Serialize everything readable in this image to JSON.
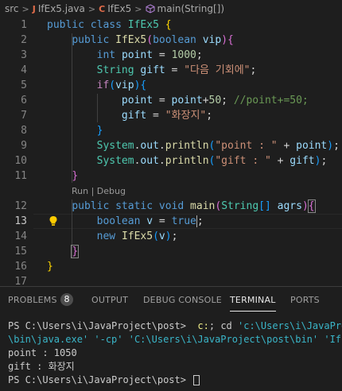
{
  "breadcrumb": {
    "folder": "src",
    "file": "IfEx5.java",
    "class_name": "IfEx5",
    "method": "main(String[])",
    "java_icon_glyph": "J"
  },
  "editor": {
    "line_numbers": [
      "1",
      "2",
      "3",
      "4",
      "5",
      "6",
      "7",
      "8",
      "9",
      "10",
      "11",
      "12",
      "13",
      "14",
      "15",
      "16",
      "17"
    ],
    "active_line": "13",
    "code_lens": "Run | Debug",
    "lines": [
      [
        [
          "public",
          "kw"
        ],
        [
          " "
        ],
        [
          "class",
          "kw"
        ],
        [
          " "
        ],
        [
          "IfEx5",
          "ty"
        ],
        [
          " "
        ],
        [
          "{",
          "b1"
        ]
      ],
      [
        [
          "    "
        ],
        [
          "public",
          "kw"
        ],
        [
          " "
        ],
        [
          "IfEx5",
          "fn"
        ],
        [
          "(",
          "b2"
        ],
        [
          "boolean",
          "kw"
        ],
        [
          " "
        ],
        [
          "vip",
          "vr"
        ],
        [
          ")",
          "b2"
        ],
        [
          "{",
          "b2"
        ]
      ],
      [
        [
          "        "
        ],
        [
          "int",
          "kw"
        ],
        [
          " "
        ],
        [
          "point",
          "vr"
        ],
        [
          " = "
        ],
        [
          "1000",
          "num"
        ],
        [
          ";"
        ]
      ],
      [
        [
          "        "
        ],
        [
          "String",
          "ty"
        ],
        [
          " "
        ],
        [
          "gift",
          "vr"
        ],
        [
          " = "
        ],
        [
          "\"다음 기회에\"",
          "str"
        ],
        [
          ";"
        ]
      ],
      [
        [
          "        "
        ],
        [
          "if",
          "ctl"
        ],
        [
          "(",
          "b3"
        ],
        [
          "vip",
          "vr"
        ],
        [
          ")",
          "b3"
        ],
        [
          "{",
          "b3"
        ]
      ],
      [
        [
          "            "
        ],
        [
          "point",
          "vr"
        ],
        [
          " = "
        ],
        [
          "point",
          "vr"
        ],
        [
          "+"
        ],
        [
          "50",
          "num"
        ],
        [
          "; "
        ],
        [
          "//point+=50;",
          "cm"
        ]
      ],
      [
        [
          "            "
        ],
        [
          "gift",
          "vr"
        ],
        [
          " = "
        ],
        [
          "\"화장지\"",
          "str"
        ],
        [
          ";"
        ]
      ],
      [
        [
          "        "
        ],
        [
          "}",
          "b3"
        ]
      ],
      [
        [
          "        "
        ],
        [
          "System",
          "ty"
        ],
        [
          "."
        ],
        [
          "out",
          "vr"
        ],
        [
          "."
        ],
        [
          "println",
          "fn"
        ],
        [
          "(",
          "b3"
        ],
        [
          "\"point : \"",
          "str"
        ],
        [
          " + "
        ],
        [
          "point",
          "vr"
        ],
        [
          ")",
          "b3"
        ],
        [
          ";"
        ]
      ],
      [
        [
          "        "
        ],
        [
          "System",
          "ty"
        ],
        [
          "."
        ],
        [
          "out",
          "vr"
        ],
        [
          "."
        ],
        [
          "println",
          "fn"
        ],
        [
          "(",
          "b3"
        ],
        [
          "\"gift : \"",
          "str"
        ],
        [
          " + "
        ],
        [
          "gift",
          "vr"
        ],
        [
          ")",
          "b3"
        ],
        [
          ";"
        ]
      ],
      [
        [
          "    "
        ],
        [
          "}",
          "b2"
        ]
      ],
      [
        [
          "    "
        ],
        [
          "public",
          "kw"
        ],
        [
          " "
        ],
        [
          "static",
          "kw"
        ],
        [
          " "
        ],
        [
          "void",
          "kw"
        ],
        [
          " "
        ],
        [
          "main",
          "fn"
        ],
        [
          "(",
          "b2"
        ],
        [
          "String",
          "ty"
        ],
        [
          "[]",
          "b3"
        ],
        [
          " "
        ],
        [
          "agrs",
          "vr"
        ],
        [
          ")",
          "b2"
        ],
        [
          "{",
          "b2",
          "box"
        ]
      ],
      [
        [
          "        "
        ],
        [
          "boolean",
          "kw"
        ],
        [
          " "
        ],
        [
          "v",
          "vr"
        ],
        [
          " = "
        ],
        [
          "true",
          "kw"
        ],
        [
          "CURSOR"
        ],
        [
          ";"
        ]
      ],
      [
        [
          "        "
        ],
        [
          "new",
          "kw"
        ],
        [
          " "
        ],
        [
          "IfEx5",
          "fn"
        ],
        [
          "(",
          "b3"
        ],
        [
          "v",
          "vr"
        ],
        [
          ")",
          "b3"
        ],
        [
          ";"
        ]
      ],
      [
        [
          "    "
        ],
        [
          "}",
          "b2",
          "box"
        ]
      ],
      [
        [
          "}",
          "b1"
        ]
      ],
      [
        [
          ""
        ]
      ]
    ]
  },
  "panel": {
    "tabs": [
      {
        "label": "PROBLEMS",
        "active": false
      },
      {
        "label": "OUTPUT",
        "active": false
      },
      {
        "label": "DEBUG CONSOLE",
        "active": false
      },
      {
        "label": "TERMINAL",
        "active": true
      },
      {
        "label": "PORTS",
        "active": false
      }
    ],
    "problems_count": "8",
    "terminal": {
      "line1_prompt": "PS C:\\Users\\i\\JavaProject\\post> ",
      "line1_cmd_a": " c:",
      "line1_cmd_b": "; cd ",
      "line1_cmd_c": "'c:\\Users\\i\\JavaProj",
      "line2": "\\bin\\java.exe' '-cp' 'C:\\Users\\i\\JavaProject\\post\\bin' 'IfEx",
      "line3": "point : 1050",
      "line4": "gift : 화장지",
      "line5_prompt": "PS C:\\Users\\i\\JavaProject\\post> "
    }
  },
  "colors": {
    "background": "#1e1e1e",
    "keyword": "#569cd6",
    "type": "#4ec9b0",
    "function": "#dcdcaa",
    "variable": "#9cdcfe",
    "number": "#b5cea8",
    "string": "#ce9178",
    "comment": "#6a9955",
    "bracket1": "#ffd700",
    "bracket2": "#da70d6",
    "bracket3": "#179fff"
  }
}
